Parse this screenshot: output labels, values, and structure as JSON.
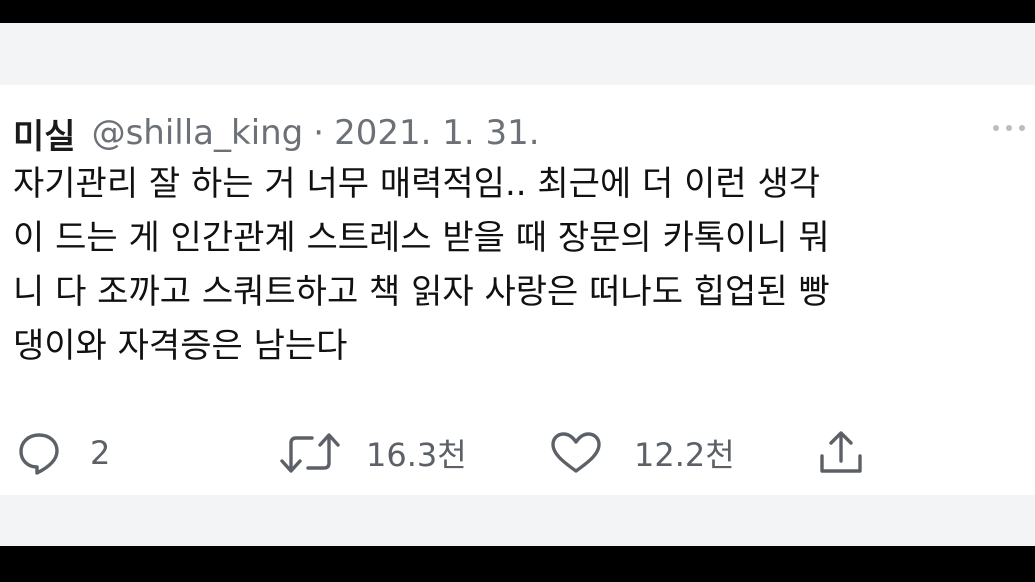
{
  "tweet": {
    "display_name": "미실",
    "handle": "@shilla_king",
    "separator": "·",
    "date": "2021. 1. 31.",
    "body_lines": [
      "자기관리 잘 하는 거 너무 매력적임.. 최근에 더 이런 생각",
      "이 드는 게 인간관계 스트레스 받을 때 장문의 카톡이니 뭐",
      "니 다 조까고 스쿼트하고 책 읽자 사랑은 떠나도 힙업된 빵",
      "댕이와 자격증은 남는다"
    ]
  },
  "actions": {
    "reply_icon": "reply-bubble-icon",
    "reply_count": "2",
    "retweet_icon": "retweet-icon",
    "retweet_count": "16.3천",
    "like_icon": "heart-icon",
    "like_count": "12.2천",
    "share_icon": "share-icon"
  },
  "colors": {
    "text": "#111111",
    "muted": "#6b7177",
    "icon": "#5b6166",
    "letterbox": "#000000",
    "strip": "#f3f4f5"
  }
}
